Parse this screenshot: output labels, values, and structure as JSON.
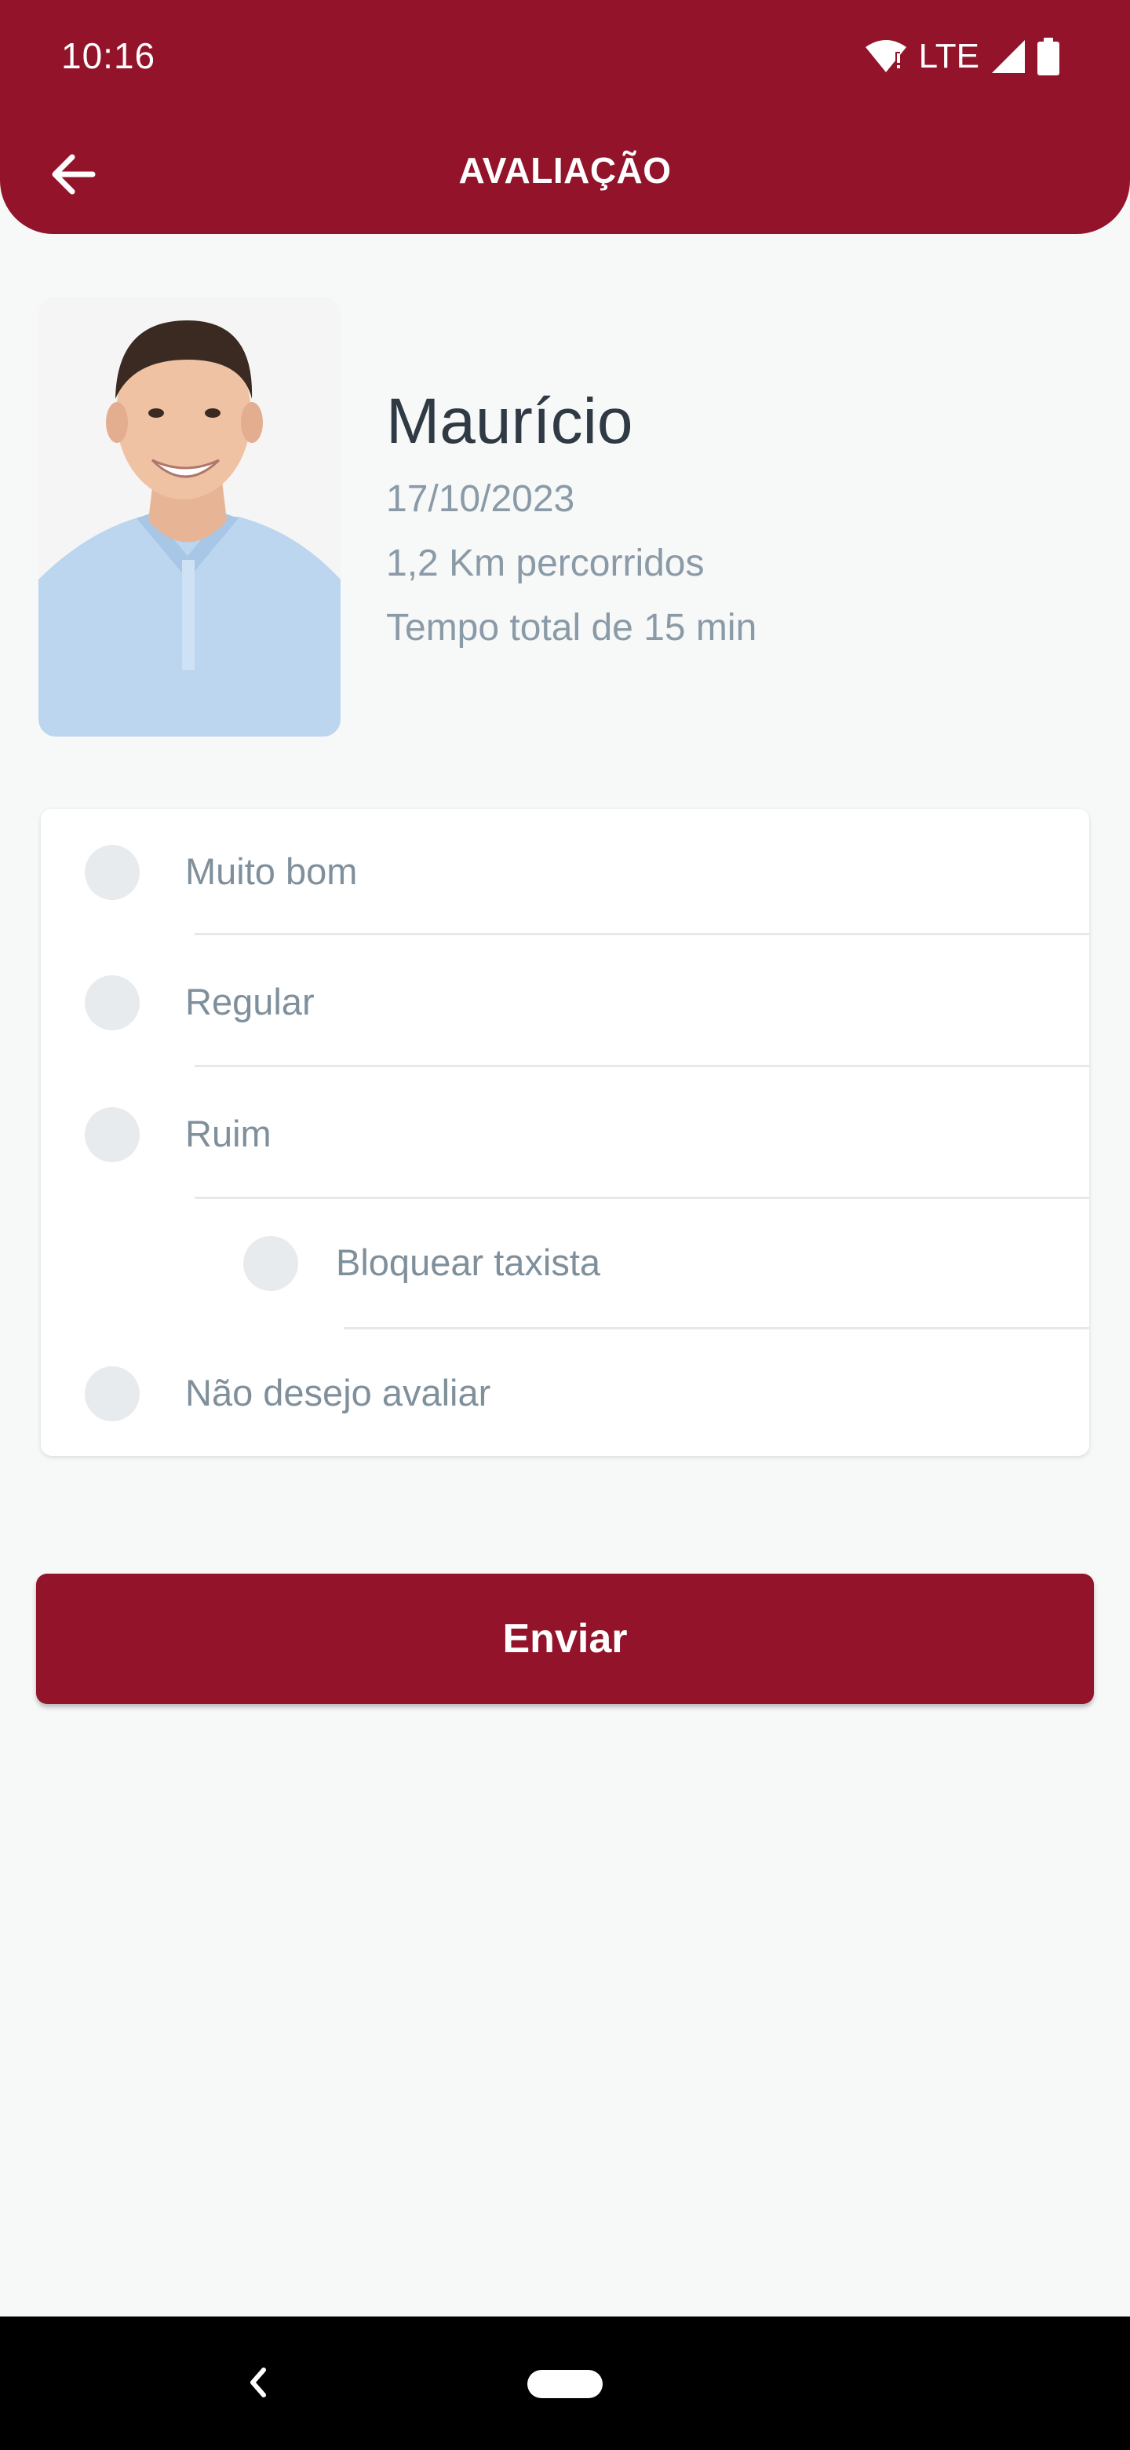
{
  "status_bar": {
    "time": "10:16",
    "network": "LTE",
    "icons": [
      "wifi-icon",
      "signal-icon",
      "battery-icon"
    ]
  },
  "header": {
    "title": "AVALIAÇÃO",
    "back_icon": "arrow-left-icon"
  },
  "driver": {
    "name": "Maurício",
    "date": "17/10/2023",
    "distance": "1,2 Km percorridos",
    "duration": "Tempo total de 15 min"
  },
  "options": [
    {
      "label": "Muito bom",
      "selected": false
    },
    {
      "label": "Regular",
      "selected": false
    },
    {
      "label": "Ruim",
      "selected": false
    },
    {
      "label": "Bloquear taxista",
      "selected": false
    },
    {
      "label": "Não desejo avaliar",
      "selected": false
    }
  ],
  "submit_label": "Enviar",
  "colors": {
    "primary": "#93142a",
    "background": "#f7f8f8",
    "radio": "#e8ebee",
    "option_text": "#7f909c",
    "name_text": "#2f3a44"
  },
  "nav_bar": {
    "icons": [
      "nav-back-icon",
      "nav-home-pill"
    ]
  }
}
